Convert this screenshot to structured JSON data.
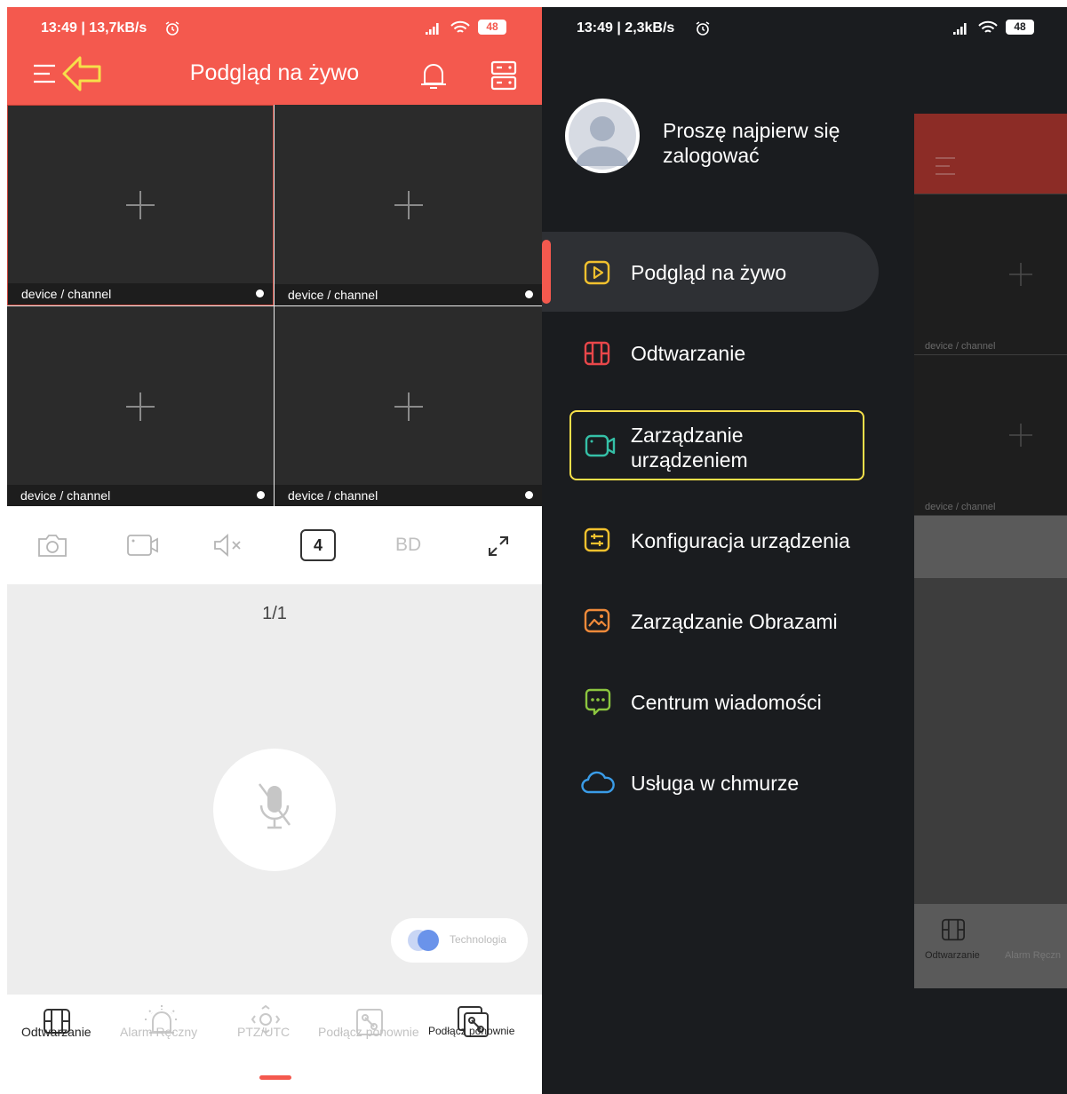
{
  "left": {
    "status": {
      "time_speed": "13:49 | 13,7kB/s",
      "battery": "48"
    },
    "header": {
      "title": "Podgląd na żywo"
    },
    "grid": {
      "cells": [
        {
          "label": "device / channel"
        },
        {
          "label": "device / channel"
        },
        {
          "label": "device / channel"
        },
        {
          "label": "device / channel"
        }
      ]
    },
    "toolbar": {
      "split_count": "4",
      "quality": "BD"
    },
    "page_indicator": "1/1",
    "tech_badge": "Technologia",
    "bottom_nav": [
      {
        "label": "Odtwarzanie"
      },
      {
        "label": "Alarm Ręczny"
      },
      {
        "label": "PTZ/UTC"
      },
      {
        "label": "Podłącz ponownie"
      },
      {
        "label": "Podłącz ponownie"
      }
    ]
  },
  "right": {
    "status": {
      "time_speed": "13:49 | 2,3kB/s",
      "battery": "48"
    },
    "profile": {
      "prompt": "Proszę najpierw się zalogować"
    },
    "menu": [
      {
        "label": "Podgląd na żywo",
        "icon": "play-square-icon",
        "color": "#f2c12e"
      },
      {
        "label": "Odtwarzanie",
        "icon": "film-icon",
        "color": "#e8474a"
      },
      {
        "label": "Zarządzanie urządzeniem",
        "icon": "video-camera-icon",
        "color": "#35c0a7"
      },
      {
        "label": "Konfiguracja urządzenia",
        "icon": "sliders-icon",
        "color": "#f2c12e"
      },
      {
        "label": "Zarządzanie Obrazami",
        "icon": "image-icon",
        "color": "#f08a3a"
      },
      {
        "label": "Centrum wiadomości",
        "icon": "message-icon",
        "color": "#8cc63f"
      },
      {
        "label": "Usługa w chmurze",
        "icon": "cloud-icon",
        "color": "#3a9ce8"
      }
    ],
    "behind": {
      "cell_label_1": "device / channel",
      "cell_label_2": "device / channel",
      "nav_label_1": "Odtwarzanie",
      "nav_label_2": "Alarm Ręczn"
    }
  },
  "colors": {
    "header_red": "#f4594e",
    "drawer_bg": "#1a1c1f",
    "highlight_yellow": "#f6e04a",
    "active_indicator": "#f4594e"
  }
}
